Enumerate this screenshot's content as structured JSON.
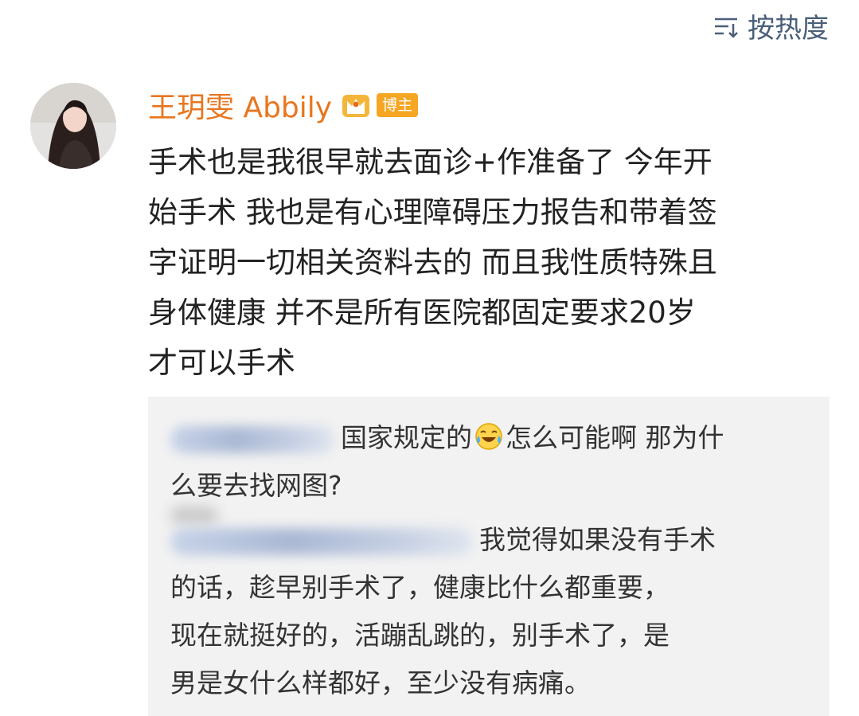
{
  "header": {
    "sort_label": "按热度",
    "sort_icon": "sort-lines-icon"
  },
  "comment": {
    "author": "王玥雯 Abbily",
    "vip_icon": "crown-vip-icon",
    "badge": "博主",
    "text": "手术也是我很早就去面诊+作准备了  今年开\n始手术 我也是有心理障碍压力报告和带着签\n字证明一切相关资料去的 而且我性质特殊且\n身体健康 并不是所有医院都固定要求20岁\n才可以手术"
  },
  "replies": [
    {
      "text_before": "国家规定的",
      "emoji": "laugh-cry-emoji-icon",
      "text_after": "怎么可能啊 那为什\n么要去找网图?"
    },
    {
      "text": "我觉得如果没有手术\n的话，趁早别手术了，健康比什么都重要，\n现在就挺好的，活蹦乱跳的，别手术了，是\n男是女什么样都好，至少没有病痛。"
    }
  ],
  "colors": {
    "username": "#e8761f",
    "badge": "#f5a623",
    "sort": "#4a5f7a",
    "reply_bg": "#f2f2f2"
  }
}
